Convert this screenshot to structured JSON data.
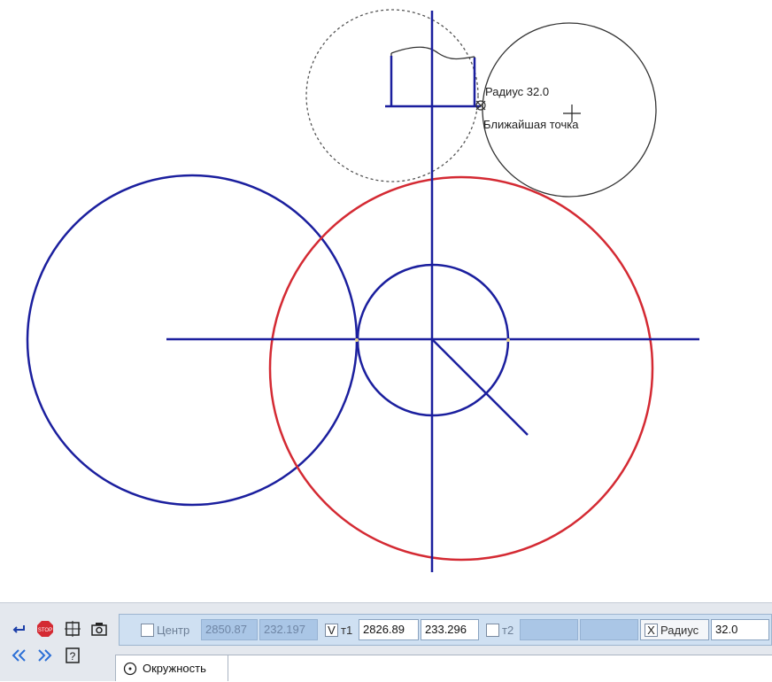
{
  "canvas": {
    "snap_radius": "Радиус 32.0",
    "snap_point": "Ближайшая точка",
    "colors": {
      "main": "#1b1f9e",
      "accent": "#d42a33",
      "preview": "#333333"
    }
  },
  "toolbar": {
    "icons": [
      "enter-icon",
      "stop-icon",
      "snap-icon",
      "camera-icon",
      "back-icon",
      "forward-icon",
      "help-icon"
    ]
  },
  "props": {
    "center_label": "Центр",
    "center_x": "2850.87",
    "center_y": "232.197",
    "t1_label": "т1",
    "t1_check": "V",
    "t1_x": "2826.89",
    "t1_y": "233.296",
    "t2_label": "т2",
    "t2_x": "",
    "t2_y": "",
    "radius_check": "X",
    "radius_label": "Радиус",
    "radius_value": "32.0"
  },
  "tabs": {
    "circle": "Окружность"
  }
}
